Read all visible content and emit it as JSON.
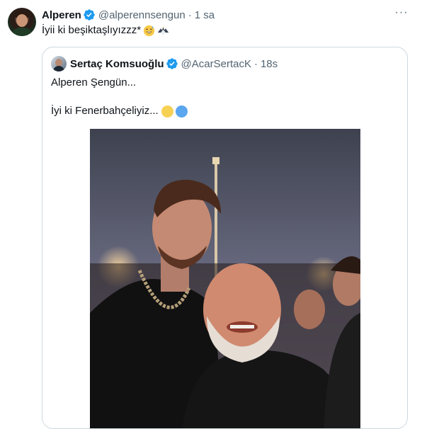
{
  "tweet": {
    "name": "Alperen",
    "handle": "@alperennsengun",
    "separator": "·",
    "time": "1 sa",
    "text": "İyii ki beşiktaşlıyızzz*",
    "emojis": [
      "grinning-sweat-face",
      "eagle-emoji"
    ],
    "more_label": "···"
  },
  "quote": {
    "name": "Sertaç Komsuoğlu",
    "handle": "@AcarSertacK",
    "separator": "·",
    "time": "18s",
    "line1": "Alperen Şengün...",
    "line2": "İyi ki Fenerbahçeliyiz...",
    "colors": {
      "yellow": "#f7d154",
      "blue": "#5aa6ef"
    }
  },
  "colors": {
    "verified": "#1d9bf0",
    "border": "#cfd9de",
    "muted": "#536471"
  }
}
